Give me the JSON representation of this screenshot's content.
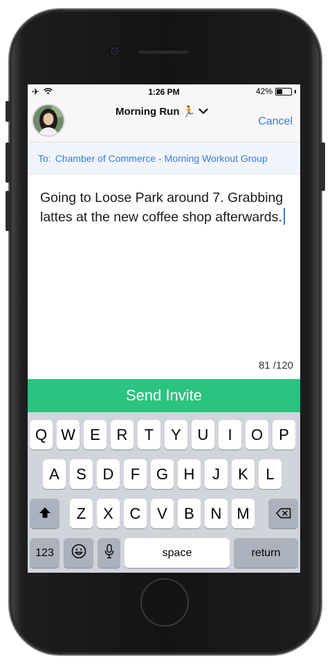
{
  "status_bar": {
    "time": "1:26 PM",
    "battery_percent": "42%",
    "battery_level": 0.42
  },
  "nav": {
    "title": "Morning Run 🏃",
    "cancel_label": "Cancel"
  },
  "to_line": {
    "label": "To:",
    "value": "Chamber of Commerce - Morning Workout Group"
  },
  "message": {
    "text": "Going to Loose Park around 7. Grabbing lattes at the new coffee shop afterwards."
  },
  "char_count": "81 /120",
  "send_button_label": "Send Invite",
  "keyboard": {
    "row1": [
      "Q",
      "W",
      "E",
      "R",
      "T",
      "Y",
      "U",
      "I",
      "O",
      "P"
    ],
    "row2": [
      "A",
      "S",
      "D",
      "F",
      "G",
      "H",
      "J",
      "K",
      "L"
    ],
    "row3": [
      "Z",
      "X",
      "C",
      "V",
      "B",
      "N",
      "M"
    ],
    "numbers_label": "123",
    "space_label": "space",
    "return_label": "return"
  },
  "colors": {
    "accent": "#3a7bd5",
    "send_green": "#2bc381"
  }
}
